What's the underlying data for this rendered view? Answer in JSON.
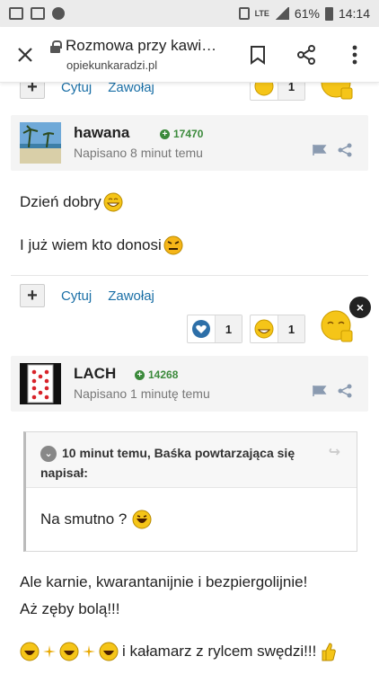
{
  "status_bar": {
    "battery": "61%",
    "time": "14:14",
    "network": "LTE"
  },
  "browser": {
    "title": "Rozmowa przy kawi…",
    "url": "opiekunkaradzi.pl"
  },
  "top_actions": {
    "quote_label": "Cytuj",
    "mention_label": "Zawołaj",
    "react_count": "1"
  },
  "post1": {
    "author": "hawana",
    "reputation": "17470",
    "posted": "Napisano 8 minut temu",
    "line1": "Dzień dobry",
    "line2": "I już wiem kto donosi",
    "quote_label": "Cytuj",
    "mention_label": "Zawołaj",
    "heart_count": "1",
    "grin_count": "1",
    "plus_label": "+",
    "close_label": "×"
  },
  "post2": {
    "author": "LACH",
    "reputation": "14268",
    "posted": "Napisano 1 minutę temu",
    "quote_header": "10 minut temu, Baśka powtarzająca się napisał:",
    "quote_body": "Na smutno ?",
    "line1": "Ale karnie, kwarantanijnie i bezpiergolijnie!",
    "line2": "Aż zęby bolą!!!",
    "line3": "i kałamarz z rylcem swędzi!!!"
  },
  "colors": {
    "link": "#1a6fa6",
    "reputation": "#3b8a3b",
    "author_bar": "#f4f4f4"
  },
  "icons": [
    "close-icon",
    "lock-icon",
    "bookmark-icon",
    "share-icon",
    "more-vert-icon",
    "flag-icon",
    "heart-icon",
    "grin-emoji-icon",
    "thumbs-up-emoji-icon",
    "angry-emoji-icon",
    "laugh-emoji-icon"
  ]
}
